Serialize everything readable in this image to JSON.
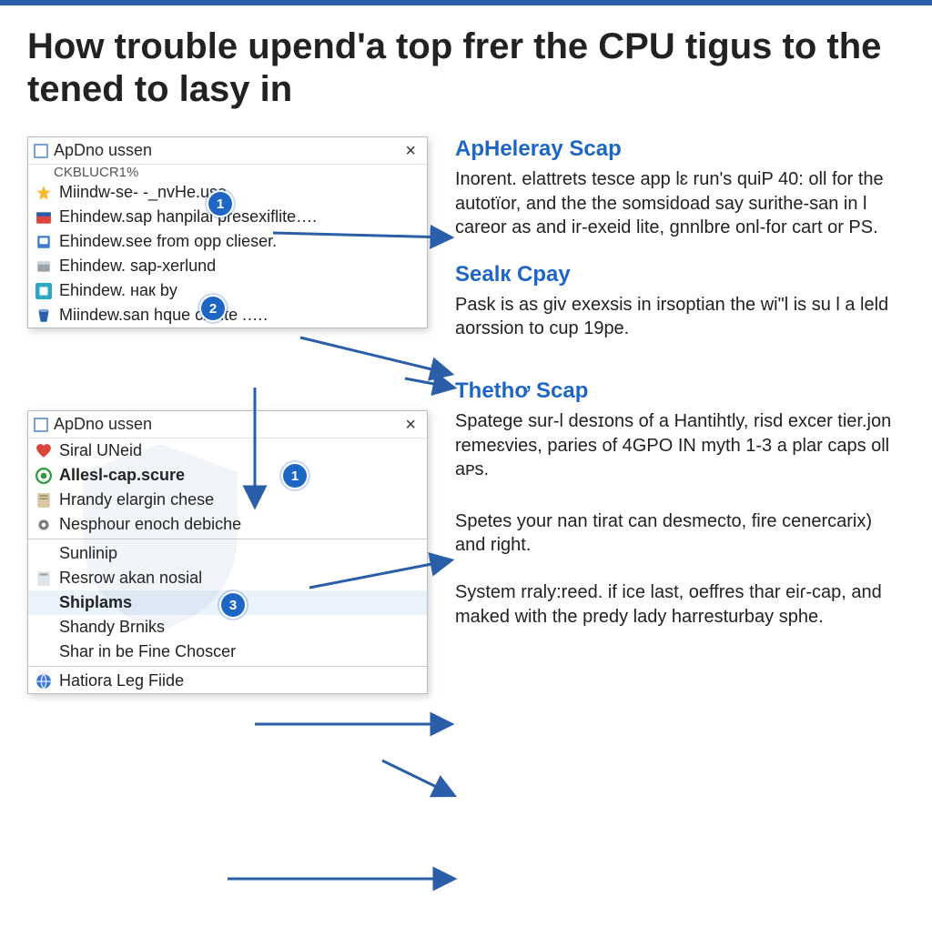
{
  "heading": "How trouble upend'a top frer the CPU tigus to the tened to lasy in",
  "win1": {
    "title": "ApDno ussen",
    "sub": "CKBLUCR1%",
    "rows": [
      {
        "icon": "star",
        "text": "Miindw-se- -_nvHe.use"
      },
      {
        "icon": "package",
        "text": "Ehindew.sap hanpilal presexiflite…."
      },
      {
        "icon": "drive",
        "text": "Ehindew.see from opp clieser."
      },
      {
        "icon": "box",
        "text": "Ehindew. sap-xerlund"
      },
      {
        "icon": "app",
        "text": "Ehindew.        нак by"
      },
      {
        "icon": "bucket",
        "text": "Miindew.san hque clcute  .…."
      }
    ]
  },
  "win2": {
    "title": "ApDno ussen",
    "rows_a": [
      {
        "icon": "heart",
        "text": "Siral UNeid"
      },
      {
        "icon": "target",
        "text": "Allesl-cap.scure",
        "bold": true
      },
      {
        "icon": "note",
        "text": "Hrandy elargin chese"
      },
      {
        "icon": "gear",
        "text": "Nesphour enoch debiche"
      }
    ],
    "rows_b": [
      {
        "icon": "",
        "text": "Sunlinip"
      },
      {
        "icon": "sheet",
        "text": "Resrow akan  nosial"
      },
      {
        "icon": "",
        "text": "Shiplams",
        "hl": true,
        "bold": true
      },
      {
        "icon": "",
        "text": "Shandy Brniks"
      },
      {
        "icon": "",
        "text": "Shar in be Fine Choscer"
      }
    ],
    "rows_c": [
      {
        "icon": "globe",
        "text": "Hatiora Leg Fiide"
      }
    ]
  },
  "sections": [
    {
      "title": "ApHeleray Scap",
      "body": "Inorent. elattrets tesce app lɛ run's quiP 40: oll for the autotïor, and the the somsidoad say surithe-san in l careor as and ir-exeid lite, gnnlbre onl-for cart or PS."
    },
    {
      "title": "Sealк Cpay",
      "body": "Pask is as giv exexsis in irsoptian the wi\"l is su l a leld aorssion to cup 19pe."
    },
    {
      "title": "Thethơ Scap",
      "body": "Spatege sur-l desɪons of a Hantihtly, risd excer tier.jon remeɛvies, paries of 4GPO IN myth 1-3 a plar caps oll aᴘs."
    },
    {
      "title": "",
      "body": "Spetes your nan tirat can desmecto, fire cenercarix) and right."
    },
    {
      "title": "",
      "body": "System rraly:reed. if ice last, oeffres thar eiɾ-cap, and maked with the predy lady harresturbay sphe."
    }
  ],
  "badges": {
    "b1": "1",
    "b2": "2",
    "b3": "1",
    "b4": "3"
  }
}
